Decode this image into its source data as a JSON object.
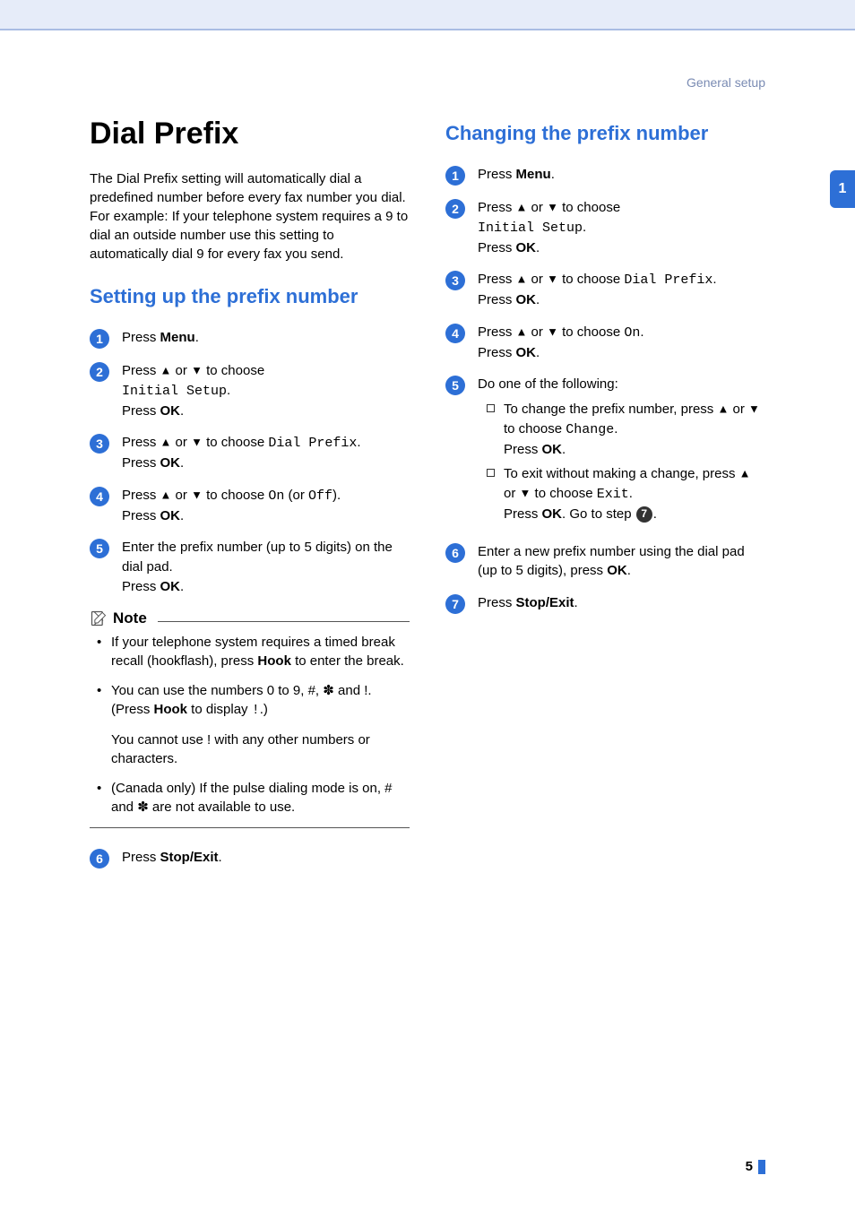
{
  "header": "General setup",
  "tabNumber": "1",
  "pageNumber": "5",
  "left": {
    "h1": "Dial Prefix",
    "intro": "The Dial Prefix setting will automatically dial a predefined number before every fax number you dial. For example: If your telephone system requires a 9 to dial an outside number use this setting to automatically dial 9 for every fax you send.",
    "h2": "Setting up the prefix number",
    "steps": {
      "s1": {
        "num": "1",
        "press": "Press ",
        "menu": "Menu",
        "dot": "."
      },
      "s2": {
        "num": "2",
        "line1a": "Press ",
        "line1up": "▲",
        "line1or": " or ",
        "line1down": "▼",
        "line1b": " to choose ",
        "mono1": "Initial Setup",
        "line1end": ".",
        "line2a": "Press ",
        "ok": "OK",
        "line2end": "."
      },
      "s3": {
        "num": "3",
        "line1a": "Press ",
        "up": "▲",
        "or": " or ",
        "down": "▼",
        "b": " to choose ",
        "mono": "Dial Prefix",
        "end": ".",
        "line2a": "Press ",
        "ok": "OK",
        "line2end": "."
      },
      "s4": {
        "num": "4",
        "a": "Press ",
        "up": "▲",
        "or": " or ",
        "down": "▼",
        "b": " to choose ",
        "mono1": "On",
        "mid": " (or ",
        "mono2": "Off",
        "end": ").",
        "l2a": "Press ",
        "ok": "OK",
        "l2end": "."
      },
      "s5": {
        "num": "5",
        "line1": "Enter the prefix number (up to 5 digits) on the dial pad.",
        "l2a": "Press ",
        "ok": "OK",
        "l2end": "."
      },
      "s6": {
        "num": "6",
        "press": "Press ",
        "btn": "Stop/Exit",
        "dot": "."
      }
    },
    "note": {
      "title": "Note",
      "b1a": "If your telephone system requires a timed break recall (hookflash), press ",
      "b1hook": "Hook",
      "b1b": " to enter the break.",
      "b2a": "You can use the numbers 0 to 9, #, ✽",
      "b2b": " and !. (Press ",
      "b2hook": "Hook",
      "b2c": " to display ",
      "b2mono": "!",
      "b2d": ".)",
      "b2sub": "You cannot use ! with any other numbers or characters.",
      "b3": "(Canada only) If the pulse dialing mode is on, # and ✽ are not available to use."
    }
  },
  "right": {
    "h2": "Changing the prefix number",
    "steps": {
      "s1": {
        "num": "1",
        "press": "Press ",
        "menu": "Menu",
        "dot": "."
      },
      "s2": {
        "num": "2",
        "a": "Press ",
        "up": "▲",
        "or": " or ",
        "down": "▼",
        "b": " to choose ",
        "mono": "Initial Setup",
        "end": ".",
        "l2a": "Press ",
        "ok": "OK",
        "l2end": "."
      },
      "s3": {
        "num": "3",
        "a": "Press ",
        "up": "▲",
        "or": " or ",
        "down": "▼",
        "b": " to choose ",
        "mono": "Dial Prefix",
        "end": ".",
        "l2a": "Press ",
        "ok": "OK",
        "l2end": "."
      },
      "s4": {
        "num": "4",
        "a": "Press ",
        "up": "▲",
        "or": " or ",
        "down": "▼",
        "b": " to choose ",
        "mono": "On",
        "end": ".",
        "l2a": "Press ",
        "ok": "OK",
        "l2end": "."
      },
      "s5": {
        "num": "5",
        "lead": "Do one of the following:",
        "sub1a": "To change the prefix number, press ",
        "sub1up": "▲",
        "sub1or": " or ",
        "sub1down": "▼",
        "sub1b": " to choose ",
        "sub1mono": "Change",
        "sub1end": ".",
        "sub1l2a": "Press ",
        "sub1ok": "OK",
        "sub1l2end": ".",
        "sub2a": "To exit without making a change, press ",
        "sub2up": "▲",
        "sub2or": " or ",
        "sub2down": "▼",
        "sub2b": " to choose ",
        "sub2mono": "Exit",
        "sub2end": ".",
        "sub2l2a": "Press ",
        "sub2ok": "OK",
        "sub2l2b": ". Go to step ",
        "sub2ref": "7",
        "sub2l2end": "."
      },
      "s6": {
        "num": "6",
        "a": "Enter a new prefix number using the dial pad (up to 5 digits), press ",
        "ok": "OK",
        "end": "."
      },
      "s7": {
        "num": "7",
        "press": "Press ",
        "btn": "Stop/Exit",
        "dot": "."
      }
    }
  }
}
